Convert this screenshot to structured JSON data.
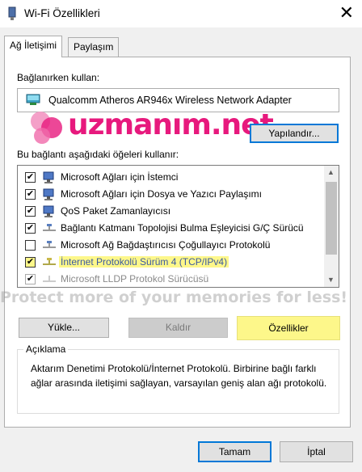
{
  "window": {
    "title": "Wi-Fi Özellikleri",
    "close_glyph": "✕"
  },
  "tabs": [
    {
      "label": "Ağ İletişimi"
    },
    {
      "label": "Paylaşım"
    }
  ],
  "connect_using": {
    "label": "Bağlanırken kullan:",
    "adapter": "Qualcomm Atheros AR946x Wireless Network Adapter",
    "configure_button": "Yapılandır..."
  },
  "watermark": {
    "brand": "uzmanım.net",
    "strip": "Protect more of your memories for less!"
  },
  "items_label": "Bu bağlantı aşağıdaki öğeleri kullanır:",
  "items": [
    {
      "label": "Microsoft Ağları için İstemci",
      "checked": true,
      "icon": "network-client-icon"
    },
    {
      "label": "Microsoft Ağları için Dosya ve Yazıcı Paylaşımı",
      "checked": true,
      "icon": "network-client-icon"
    },
    {
      "label": "QoS Paket Zamanlayıcısı",
      "checked": true,
      "icon": "network-client-icon"
    },
    {
      "label": "Bağlantı Katmanı Topolojisi Bulma Eşleyicisi G/Ç Sürücü",
      "checked": true,
      "icon": "protocol-icon"
    },
    {
      "label": "Microsoft Ağ Bağdaştırıcısı Çoğullayıcı Protokolü",
      "checked": false,
      "icon": "protocol-icon"
    },
    {
      "label": "İnternet Protokolü Sürüm 4 (TCP/IPv4)",
      "checked": true,
      "icon": "protocol-icon"
    },
    {
      "label": "Microsoft LLDP Protokol Sürücüsü",
      "checked": true,
      "icon": "protocol-icon"
    }
  ],
  "actions": {
    "install": "Yükle...",
    "uninstall": "Kaldır",
    "properties": "Özellikler"
  },
  "description": {
    "title": "Açıklama",
    "text": "Aktarım Denetimi Protokolü/İnternet Protokolü. Birbirine bağlı farklı ağlar arasında iletişimi sağlayan, varsayılan geniş alan ağı protokolü."
  },
  "footer": {
    "ok": "Tamam",
    "cancel": "İptal"
  },
  "colors": {
    "highlight": "#fdf78a",
    "focus_border": "#0078d7",
    "watermark_pink": "#e7197d"
  }
}
